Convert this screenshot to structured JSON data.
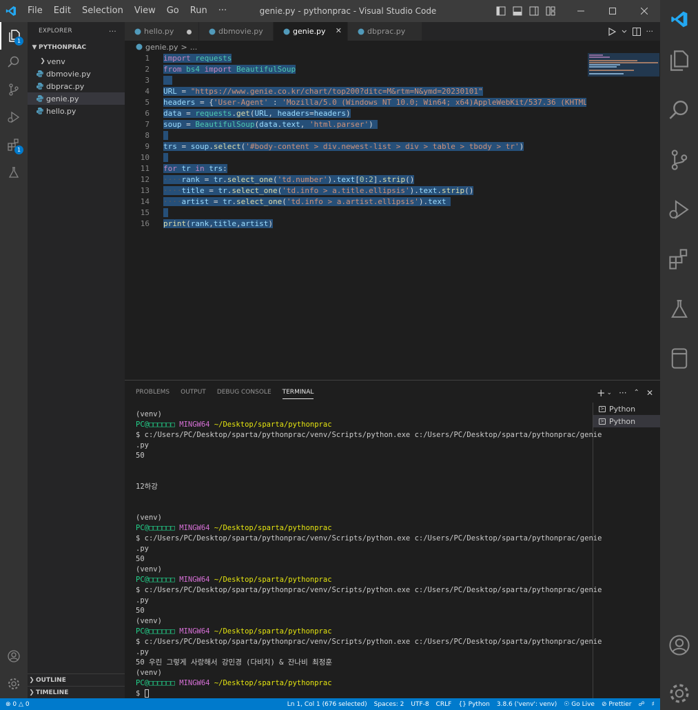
{
  "app": {
    "window_title": "genie.py - pythonprac - Visual Studio Code",
    "menu": [
      "File",
      "Edit",
      "Selection",
      "View",
      "Go",
      "Run",
      "···"
    ]
  },
  "activity": {
    "explorer_badge": "1",
    "extensions_badge": "1"
  },
  "sidebar": {
    "header": "EXPLORER",
    "more": "···",
    "folder": "PYTHONPRAC",
    "items": [
      {
        "label": "venv"
      },
      {
        "label": "dbmovie.py"
      },
      {
        "label": "dbprac.py"
      },
      {
        "label": "genie.py"
      },
      {
        "label": "hello.py"
      }
    ],
    "outline": "OUTLINE",
    "timeline": "TIMELINE"
  },
  "tabs": [
    {
      "label": "hello.py"
    },
    {
      "label": "dbmovie.py"
    },
    {
      "label": "genie.py"
    },
    {
      "label": "dbprac.py"
    }
  ],
  "breadcrumb": {
    "file": "genie.py",
    "sep": ">",
    "trail": "..."
  },
  "editor": {
    "line_numbers": [
      "1",
      "2",
      "3",
      "4",
      "5",
      "6",
      "7",
      "8",
      "9",
      "10",
      "11",
      "12",
      "13",
      "14",
      "15",
      "16"
    ],
    "code": {
      "l1": [
        "import",
        "requests"
      ],
      "l2": [
        "from",
        "bs4",
        "import",
        "BeautifulSoup"
      ],
      "l4": [
        "URL",
        "=",
        "\"https://www.genie.co.kr/chart/top200?ditc=M&rtm=N&ymd=20230101\""
      ],
      "l5": [
        "headers",
        "=",
        "{",
        "'User-Agent'",
        ":",
        "'Mozilla/5.0 (Windows NT 10.0; Win64; x64)AppleWebKit/537.36 (KHTML,"
      ],
      "l6": [
        "data",
        "=",
        "requests",
        ".",
        "get",
        "(",
        "URL",
        ",",
        "headers",
        "=",
        "headers",
        ")"
      ],
      "l7": [
        "soup",
        "=",
        "BeautifulSoup",
        "(",
        "data",
        ".",
        "text",
        ",",
        "'html.parser'",
        ")"
      ],
      "l9": [
        "trs",
        "=",
        "soup",
        ".",
        "select",
        "(",
        "'#body-content > div.newest-list > div > table > tbody > tr'",
        ")"
      ],
      "l11": [
        "for",
        "tr",
        "in",
        "trs",
        ":"
      ],
      "l12": [
        "rank",
        "=",
        "tr",
        ".",
        "select_one",
        "(",
        "'td.number'",
        ").",
        "text",
        "[",
        "0",
        ":",
        "2",
        "].",
        "strip",
        "()"
      ],
      "l13": [
        "title",
        "=",
        "tr",
        ".",
        "select_one",
        "(",
        "'td.info > a.title.ellipsis'",
        ").",
        "text",
        ".",
        "strip",
        "()"
      ],
      "l14": [
        "artist",
        "=",
        "tr",
        ".",
        "select_one",
        "(",
        "'td.info > a.artist.ellipsis'",
        ").",
        "text"
      ],
      "l16": [
        "print",
        "(",
        "rank",
        ",",
        "title",
        ",",
        "artist",
        ")"
      ]
    }
  },
  "panel": {
    "tabs": [
      "PROBLEMS",
      "OUTPUT",
      "DEBUG CONSOLE",
      "TERMINAL"
    ],
    "terminals": [
      "Python",
      "Python"
    ],
    "terminal": {
      "venv": "(venv)",
      "user": "PC@□□□□□□",
      "host": "MINGW64",
      "path": "~/Desktop/sparta/pythonprac",
      "cmd": "$ c:/Users/PC/Desktop/sparta/pythonprac/venv/Scripts/python.exe c:/Users/PC/Desktop/sparta/pythonprac/genie",
      "cmd_cont": ".py",
      "out_50": "50",
      "out_12": "12하강",
      "out_last": "50 우린 그렇게 사랑해서 강민경 (다비치) & 잔나비 최정훈",
      "prompt": "$"
    }
  },
  "status": {
    "errors": "0",
    "warnings": "0",
    "position": "Ln 1, Col 1 (676 selected)",
    "spaces": "Spaces: 2",
    "encoding": "UTF-8",
    "eol": "CRLF",
    "language": "Python",
    "interpreter": "3.8.6 ('venv': venv)",
    "golive": "Go Live",
    "prettier": "Prettier"
  },
  "colors": {
    "accent": "#007acc",
    "selection": "#264f78",
    "keyword": "#c586c0",
    "string": "#ce9178",
    "function": "#dcdcaa",
    "variable": "#9cdcfe",
    "type": "#4ec9b0"
  }
}
